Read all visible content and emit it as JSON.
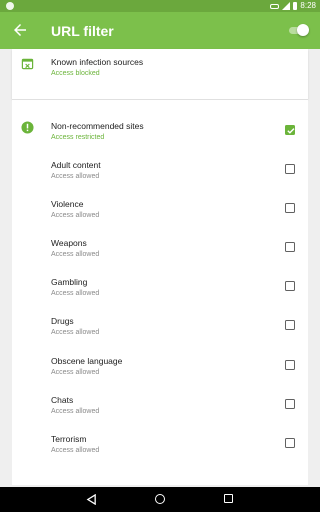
{
  "status_bar": {
    "time": "8:28"
  },
  "app_bar": {
    "title": "URL filter",
    "toggle_on": true
  },
  "top_item": {
    "label": "Known infection sources",
    "status": "Access blocked",
    "icon": "block-list-icon"
  },
  "categories": [
    {
      "label": "Non-recommended sites",
      "status": "Access restricted",
      "checked": true,
      "icon": "warning-icon"
    },
    {
      "label": "Adult content",
      "status": "Access allowed",
      "checked": false
    },
    {
      "label": "Violence",
      "status": "Access allowed",
      "checked": false
    },
    {
      "label": "Weapons",
      "status": "Access allowed",
      "checked": false
    },
    {
      "label": "Gambling",
      "status": "Access allowed",
      "checked": false
    },
    {
      "label": "Drugs",
      "status": "Access allowed",
      "checked": false
    },
    {
      "label": "Obscene language",
      "status": "Access allowed",
      "checked": false
    },
    {
      "label": "Chats",
      "status": "Access allowed",
      "checked": false
    },
    {
      "label": "Terrorism",
      "status": "Access allowed",
      "checked": false
    }
  ],
  "colors": {
    "primary": "#7cc04b",
    "primary_dark": "#6ba83d",
    "accent": "#6bb43a"
  }
}
